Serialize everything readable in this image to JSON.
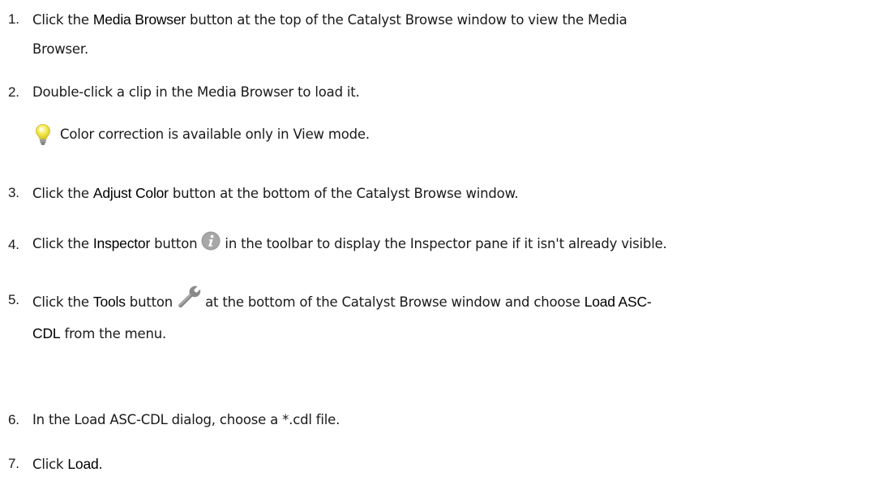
{
  "steps": [
    {
      "number": "1.",
      "parts": [
        "Click the ",
        "Media Browser",
        " button at the top of the Catalyst Browse window to view the Media",
        "Browser."
      ]
    },
    {
      "number": "2.",
      "text": "Double-click a clip in the Media Browser to load it."
    },
    {
      "number": "3.",
      "parts": [
        "Click the ",
        "Adjust Color",
        " button at the bottom of the Catalyst Browse window."
      ]
    },
    {
      "number": "4.",
      "parts": [
        "Click the ",
        "Inspector",
        " button ",
        " in the toolbar to display the Inspector pane if it isn't already visible."
      ]
    },
    {
      "number": "5.",
      "parts": [
        "Click the ",
        "Tools",
        " button ",
        " at the bottom of the Catalyst Browse window and choose ",
        "Load ASC-",
        "CDL",
        " from the menu."
      ]
    },
    {
      "number": "6.",
      "text": "In the Load ASC-CDL dialog, choose a *.cdl file."
    },
    {
      "number": "7.",
      "parts": [
        "Click ",
        "Load",
        "."
      ]
    }
  ],
  "tip": {
    "icon": "lightbulb-icon",
    "text": "Color correction is available only in View mode."
  },
  "icons": {
    "inspector": "info-icon",
    "tools": "wrench-icon"
  },
  "colors": {
    "info_icon": "#9a9a9a",
    "wrench_icon": "#8a8a8a",
    "bulb": "#f2e64a"
  }
}
